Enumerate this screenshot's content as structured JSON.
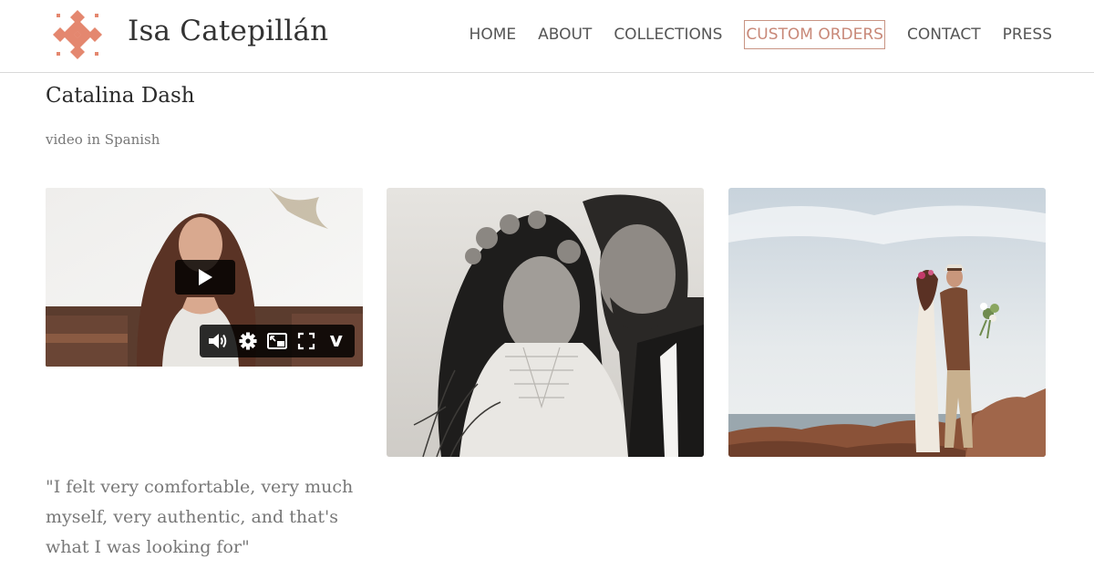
{
  "site": {
    "title": "Isa Catepillán"
  },
  "nav": {
    "items": [
      {
        "label": "HOME"
      },
      {
        "label": "ABOUT"
      },
      {
        "label": "COLLECTIONS"
      },
      {
        "label": "CUSTOM ORDERS",
        "active": true
      },
      {
        "label": "CONTACT"
      },
      {
        "label": "PRESS"
      }
    ]
  },
  "page": {
    "title": "Catalina Dash",
    "subtitle": "video in Spanish",
    "quote": "\"I felt very comfortable, very much myself, very authentic, and that's what I was looking for\""
  },
  "video": {
    "controls": [
      "volume-icon",
      "settings-icon",
      "pip-icon",
      "fullscreen-icon",
      "vimeo-icon"
    ]
  },
  "colors": {
    "accent": "#c88878",
    "logo": "#e4876f",
    "text": "#333333",
    "muted": "#777777"
  }
}
